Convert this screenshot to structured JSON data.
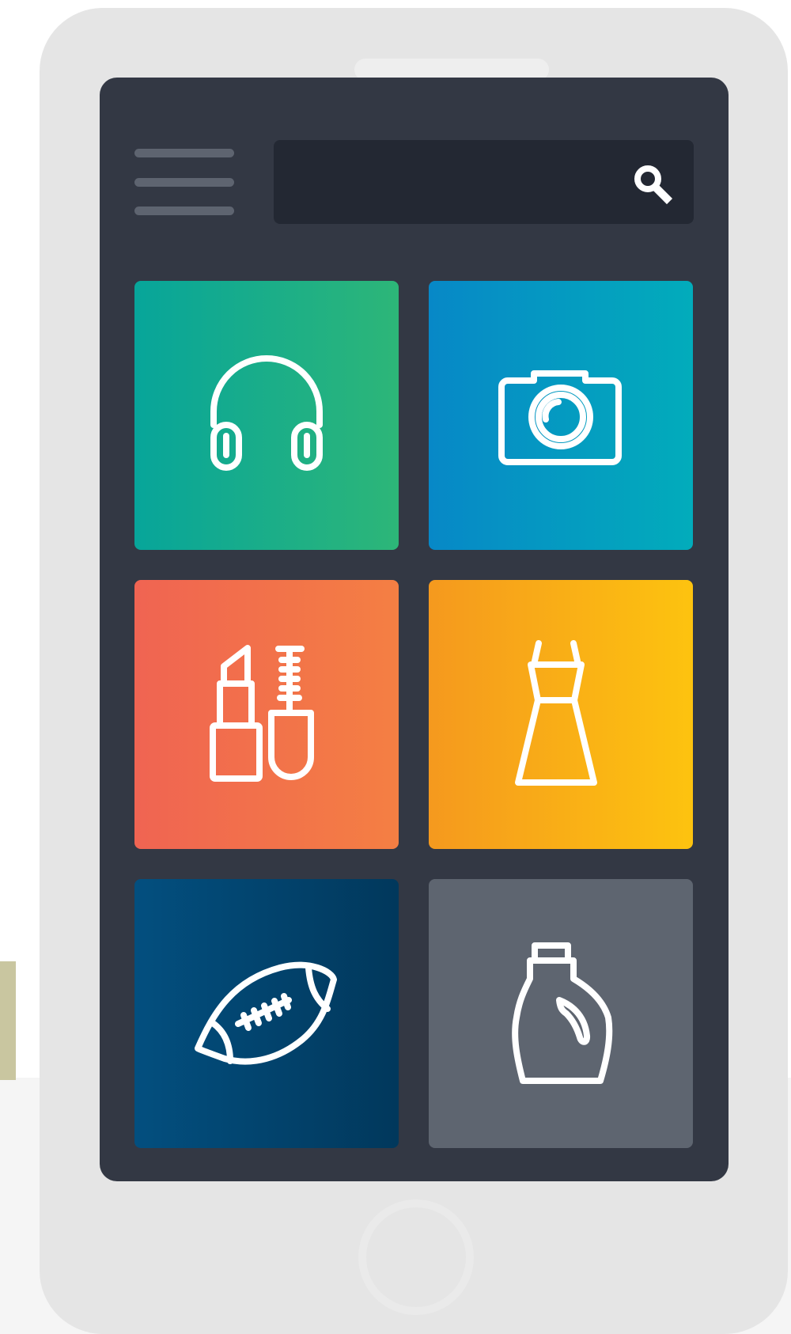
{
  "colors": {
    "background": "#ffffff",
    "floor": "#f5f5f5",
    "stand_stripe": "#c9c6a0",
    "phone_body": "#e5e5e5",
    "screen": "#333844",
    "search_field": "#232833",
    "menu_bars": "#5e6470",
    "icon_stroke": "#ffffff"
  },
  "header": {
    "menu_icon": "hamburger-menu-icon",
    "search": {
      "value": "",
      "placeholder": "",
      "icon": "search-icon"
    }
  },
  "categories": [
    {
      "icon": "headphones-icon",
      "gradient": [
        "#07a59a",
        "#2db678"
      ]
    },
    {
      "icon": "camera-icon",
      "gradient": [
        "#0788c7",
        "#02acbb"
      ]
    },
    {
      "icon": "lipstick-mascara-icon",
      "gradient": [
        "#f06452",
        "#f47f43"
      ]
    },
    {
      "icon": "dress-icon",
      "gradient": [
        "#f5991e",
        "#fdc30f"
      ]
    },
    {
      "icon": "football-icon",
      "gradient": [
        "#034f7f",
        "#01385c"
      ]
    },
    {
      "icon": "detergent-bottle-icon",
      "gradient": [
        "#5e6570",
        "#5e6570"
      ]
    }
  ],
  "home_button_icon": "home-button-icon"
}
